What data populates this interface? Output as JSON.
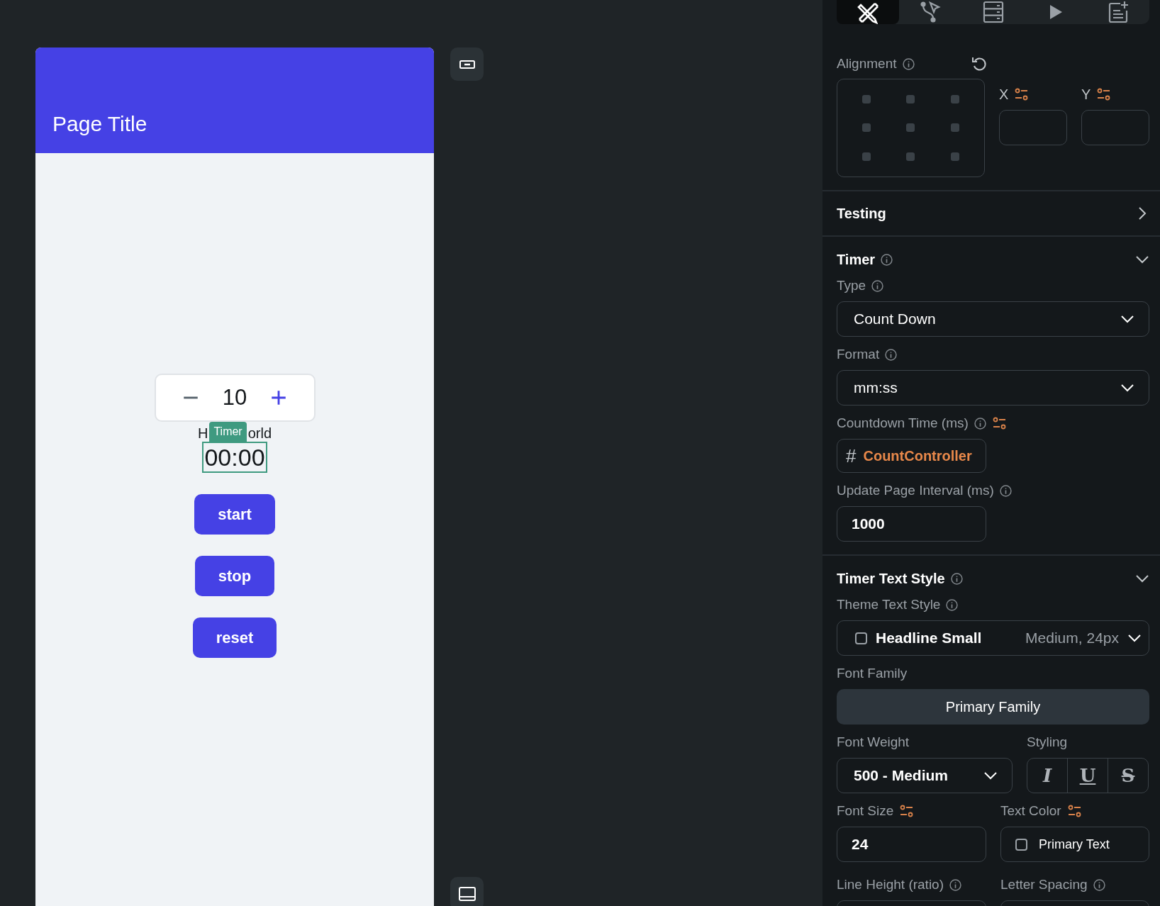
{
  "canvas": {
    "page_title": "Page Title",
    "counter": {
      "value": "10"
    },
    "hello_world_visible": [
      "H",
      "orld"
    ],
    "timer_tag": "Timer",
    "timer_value": "00:00",
    "buttons": [
      "start",
      "stop",
      "reset"
    ]
  },
  "toolbar_tabs": [
    {
      "kind": "design",
      "selected": true
    },
    {
      "kind": "logic",
      "selected": false
    },
    {
      "kind": "data",
      "selected": false
    },
    {
      "kind": "run",
      "selected": false
    },
    {
      "kind": "notes",
      "selected": false
    }
  ],
  "alignment": {
    "label": "Alignment",
    "x_label": "X",
    "y_label": "Y"
  },
  "sections": [
    {
      "title": "Testing",
      "expanded": false
    },
    {
      "title": "Timer",
      "expanded": true
    },
    {
      "title": "Timer Text Style",
      "expanded": true
    }
  ],
  "timer": {
    "type_label": "Type",
    "type_value": "Count Down",
    "format_label": "Format",
    "format_value": "mm:ss",
    "countdown_label": "Countdown Time (ms)",
    "countdown_symbol": "#",
    "countdown_value": "CountController",
    "interval_label": "Update Page Interval (ms)",
    "interval_value": "1000"
  },
  "text_style": {
    "theme_label": "Theme Text Style",
    "theme_checked": false,
    "theme_value": "Headline Small",
    "theme_detail": "Medium, 24px",
    "family_label": "Font Family",
    "family_value": "Primary Family",
    "weight_label": "Font Weight",
    "weight_value": "500 - Medium",
    "styling_label": "Styling",
    "styling": [
      {
        "kind": "italic",
        "glyph": "I"
      },
      {
        "kind": "underline",
        "glyph": "U"
      },
      {
        "kind": "strike",
        "glyph": "S"
      }
    ],
    "size_label": "Font Size",
    "size_value": "24",
    "color_label": "Text Color",
    "color_checked": false,
    "color_value": "Primary Text",
    "line_height_label": "Line Height (ratio)",
    "letter_spacing_label": "Letter Spacing"
  }
}
